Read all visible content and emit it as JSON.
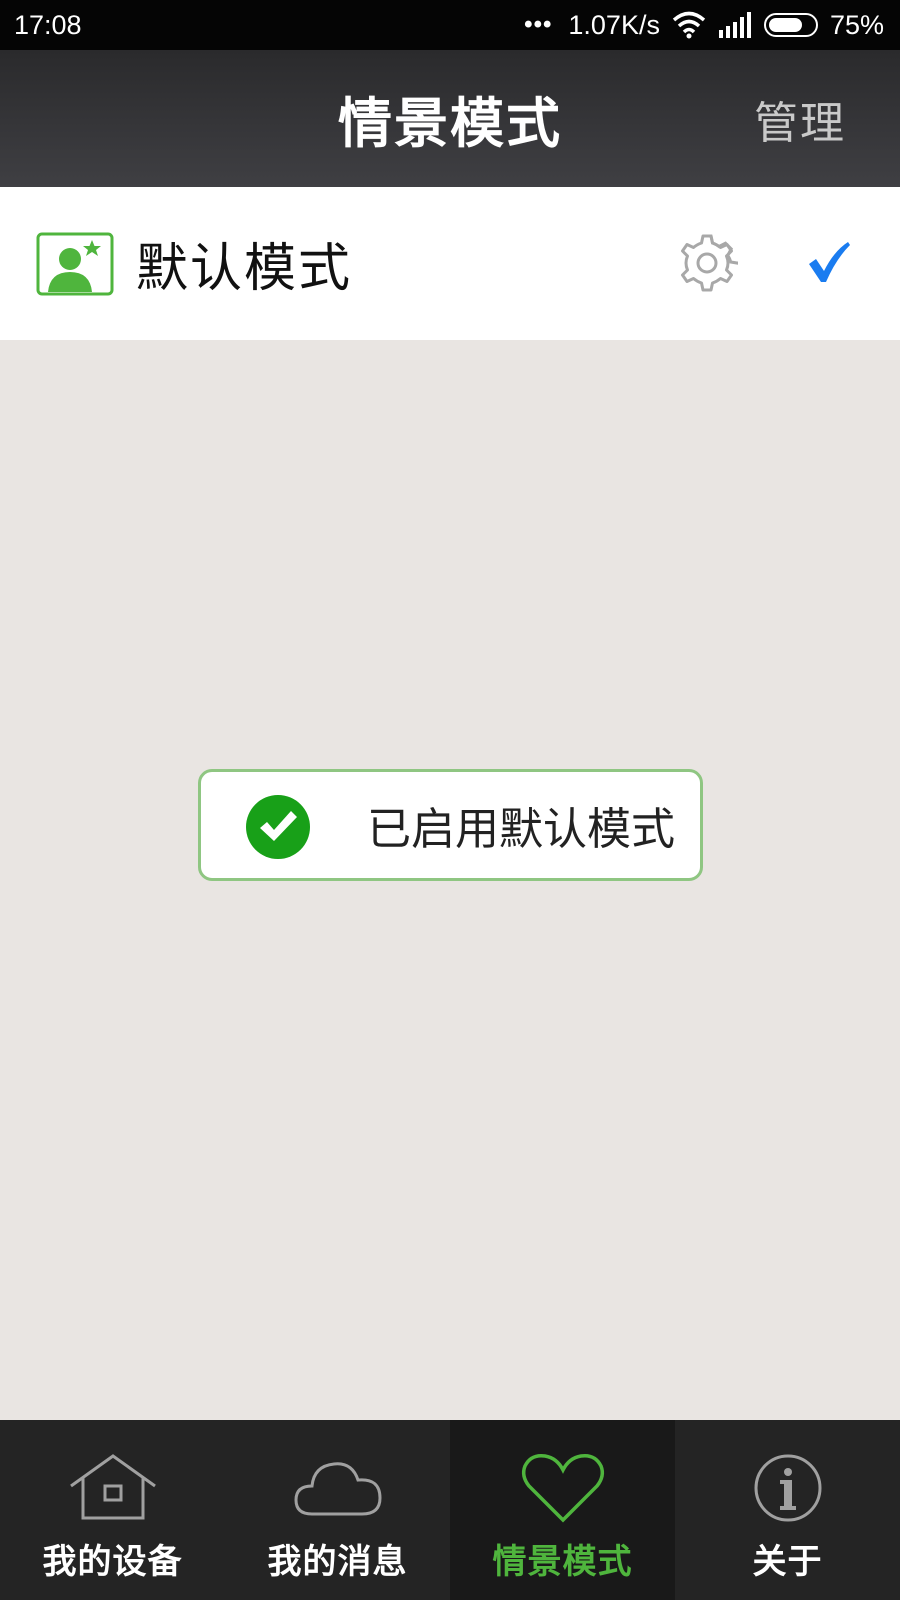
{
  "status_bar": {
    "time": "17:08",
    "dots": "•••",
    "speed": "1.07K/s",
    "battery": "75%",
    "battery_level": 0.75
  },
  "header": {
    "title": "情景模式",
    "manage_label": "管理"
  },
  "mode_list": [
    {
      "label": "默认模式",
      "selected": true
    }
  ],
  "toast": {
    "text": "已启用默认模式"
  },
  "bottom_nav": {
    "items": [
      {
        "label": "我的设备",
        "icon": "home-icon"
      },
      {
        "label": "我的消息",
        "icon": "cloud-icon"
      },
      {
        "label": "情景模式",
        "icon": "heart-icon",
        "active": true
      },
      {
        "label": "关于",
        "icon": "info-icon"
      }
    ]
  },
  "colors": {
    "accent_green": "#4fb53d",
    "check_blue": "#1a7cf0",
    "toast_border": "#8fc682"
  }
}
